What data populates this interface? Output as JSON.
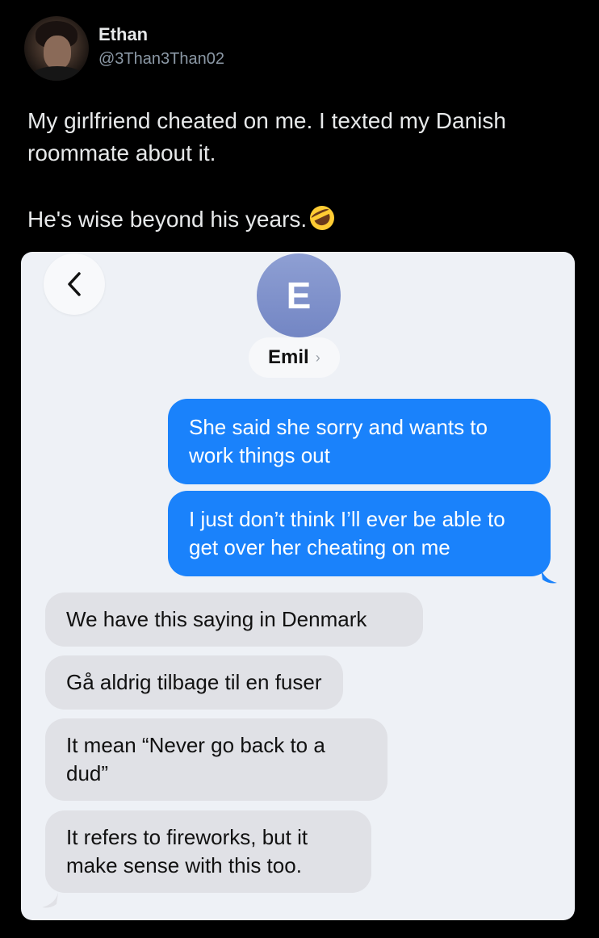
{
  "tweet": {
    "display_name": "Ethan",
    "handle": "@3Than3Than02",
    "text_line1": "My girlfriend cheated on me. I texted my Danish roommate about it.",
    "text_line2": "He's wise beyond his years.",
    "emoji_icon": "rolling-on-floor-laughing-emoji"
  },
  "conversation": {
    "back_icon": "chevron-left-icon",
    "contact_initial": "E",
    "contact_name": "Emil",
    "contact_chevron": "›",
    "sent_color": "#1a82fb",
    "received_color": "#e0e1e6",
    "messages": [
      {
        "direction": "sent",
        "text": "She said she sorry and wants to work things out"
      },
      {
        "direction": "sent",
        "text": "I just don’t think I’ll ever be able to get over her cheating on me"
      },
      {
        "direction": "received",
        "text": "We have this saying in Denmark"
      },
      {
        "direction": "received",
        "text": "Gå aldrig tilbage til en fuser"
      },
      {
        "direction": "received",
        "text": "It mean “Never go back to a dud”"
      },
      {
        "direction": "received",
        "text": "It refers to fireworks, but it make sense with this too."
      }
    ]
  }
}
